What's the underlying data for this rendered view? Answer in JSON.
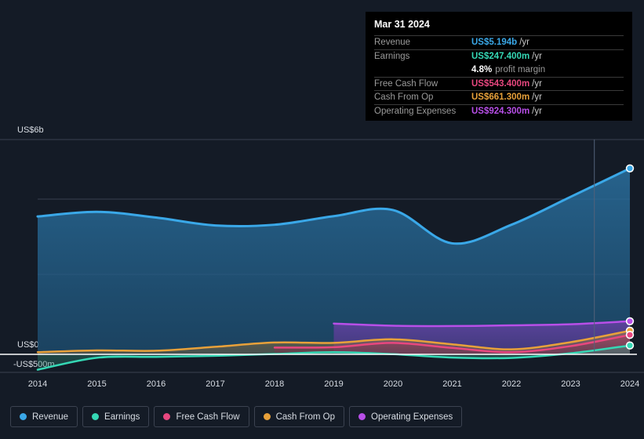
{
  "tooltip": {
    "date": "Mar 31 2024",
    "rows": [
      {
        "label": "Revenue",
        "value": "US$5.194b",
        "unit": "/yr",
        "color": "#3aa8e8"
      },
      {
        "label": "Earnings",
        "value": "US$247.400m",
        "unit": "/yr",
        "color": "#35d8b5"
      },
      {
        "label": "",
        "value": "4.8%",
        "unit": "",
        "margin_label": "profit margin",
        "color": "#ffffff"
      },
      {
        "label": "Free Cash Flow",
        "value": "US$543.400m",
        "unit": "/yr",
        "color": "#e8477f"
      },
      {
        "label": "Cash From Op",
        "value": "US$661.300m",
        "unit": "/yr",
        "color": "#e8a13a"
      },
      {
        "label": "Operating Expenses",
        "value": "US$924.300m",
        "unit": "/yr",
        "color": "#b84fe8"
      }
    ]
  },
  "axis": {
    "y_top": "US$6b",
    "y_zero": "US$0",
    "y_neg": "-US$500m"
  },
  "legend": [
    {
      "label": "Revenue",
      "color": "#3aa8e8"
    },
    {
      "label": "Earnings",
      "color": "#35d8b5"
    },
    {
      "label": "Free Cash Flow",
      "color": "#e8477f"
    },
    {
      "label": "Cash From Op",
      "color": "#e8a13a"
    },
    {
      "label": "Operating Expenses",
      "color": "#b84fe8"
    }
  ],
  "chart_data": {
    "type": "area",
    "title": "",
    "xlabel": "",
    "ylabel": "",
    "grid": true,
    "legend_position": "bottom",
    "ylim": [
      -500,
      6000
    ],
    "yunit": "US$ millions",
    "ytick_values": [
      6000,
      4500,
      3000,
      0,
      -500
    ],
    "ytick_labels": [
      "US$6b",
      "",
      "",
      "US$0",
      "-US$500m"
    ],
    "categories": [
      "2014",
      "2015",
      "2016",
      "2017",
      "2018",
      "2019",
      "2020",
      "2021",
      "2022",
      "2023",
      "2024"
    ],
    "x": [
      2014,
      2015,
      2016,
      2017,
      2018,
      2019,
      2020,
      2021,
      2022,
      2023,
      2024
    ],
    "forecast_divider_x": 2023.4,
    "series": [
      {
        "name": "Revenue",
        "color": "#3aa8e8",
        "values": [
          3850,
          3980,
          3820,
          3600,
          3620,
          3860,
          4030,
          3100,
          3620,
          4400,
          5194
        ]
      },
      {
        "name": "Earnings",
        "color": "#35d8b5",
        "values": [
          -430,
          -95,
          -70,
          -40,
          10,
          60,
          5,
          -90,
          -100,
          30,
          247.4
        ]
      },
      {
        "name": "Free Cash Flow",
        "color": "#e8477f",
        "values": [
          null,
          null,
          null,
          null,
          190,
          200,
          320,
          180,
          60,
          230,
          543.4
        ]
      },
      {
        "name": "Cash From Op",
        "color": "#e8a13a",
        "values": [
          60,
          110,
          100,
          210,
          330,
          320,
          420,
          280,
          140,
          340,
          661.3
        ]
      },
      {
        "name": "Operating Expenses",
        "color": "#b84fe8",
        "values": [
          null,
          null,
          null,
          null,
          null,
          860,
          800,
          790,
          810,
          840,
          924.3
        ]
      }
    ],
    "end_markers": [
      {
        "name": "Revenue",
        "value": 5194,
        "color": "#3aa8e8"
      },
      {
        "name": "Operating Expenses",
        "value": 924.3,
        "color": "#b84fe8"
      },
      {
        "name": "Cash From Op",
        "value": 661.3,
        "color": "#e8a13a"
      },
      {
        "name": "Free Cash Flow",
        "value": 543.4,
        "color": "#e8477f"
      },
      {
        "name": "Earnings",
        "value": 247.4,
        "color": "#35d8b5"
      }
    ]
  }
}
